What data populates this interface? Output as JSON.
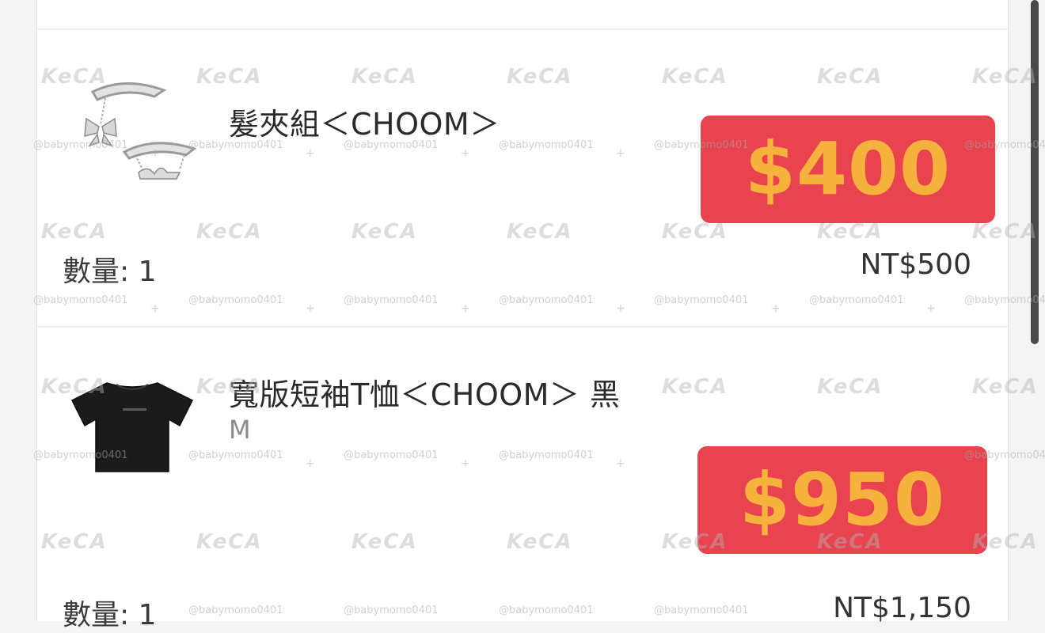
{
  "cart": {
    "items": [
      {
        "title": "髮夾組＜CHOOM＞",
        "variant": "",
        "quantity_label": "數量: 1",
        "original_price": "NT$500",
        "sale_price": "$400",
        "thumbnail_icon": "hairpin-set-thumbnail"
      },
      {
        "title": "寬版短袖T恤＜CHOOM＞ 黑",
        "variant": "M",
        "quantity_label": "數量: 1",
        "original_price": "NT$1,150",
        "sale_price": "$950",
        "thumbnail_icon": "black-tshirt-thumbnail"
      }
    ]
  },
  "watermark": {
    "brand": "KeCA",
    "handle": "@babymomo0401"
  },
  "colors": {
    "badge_background": "#e8434f",
    "badge_text": "#f6b23c",
    "panel_background": "#ffffff"
  }
}
